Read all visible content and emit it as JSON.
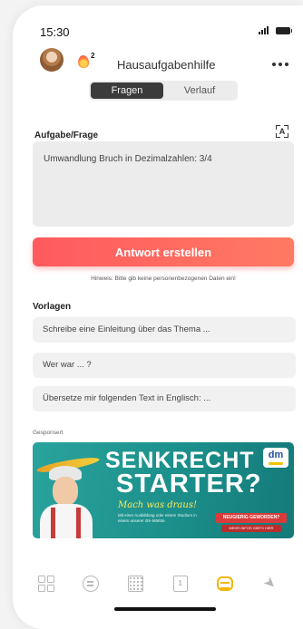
{
  "status_bar": {
    "time": "15:30"
  },
  "header": {
    "title": "Hausaufgabenhilfe",
    "streak_count": "2"
  },
  "tabs": [
    {
      "label": "Fragen",
      "active": true
    },
    {
      "label": "Verlauf",
      "active": false
    }
  ],
  "question": {
    "label": "Aufgabe/Frage",
    "value": "Umwandlung Bruch in Dezimalzahlen: 3/4"
  },
  "cta": {
    "label": "Antwort erstellen"
  },
  "hint": "Hinweis: Bitte gib keine personenbezogenen Daten ein!",
  "templates": {
    "label": "Vorlagen",
    "items": [
      "Schreibe eine Einleitung über das Thema ...",
      "Wer war ... ?",
      "Übersetze mir folgenden Text in Englisch: ..."
    ]
  },
  "ad": {
    "sponsored_label": "Gesponsert",
    "headline_1": "SENKRECHT",
    "headline_2": "STARTER?",
    "script": "Mach was draus!",
    "small_text": "Mit einer Ausbildung oder einem Studium in einem unserer dm-Märkte.",
    "logo": "dm",
    "badge_1": "NEUGIERIG GEWORDEN?",
    "badge_2": "MEHR INFOS GIBTS HIER"
  },
  "bottom_nav": {
    "items": [
      "dashboard-icon",
      "chat-icon",
      "calendar-icon",
      "flashcards-icon",
      "bot-icon",
      "rocket-icon"
    ],
    "active": "bot-icon",
    "active_color": "#f2b500",
    "inactive_color": "#b8b8b8"
  },
  "colors": {
    "cta_gradient_start": "#ff5a5f",
    "cta_gradient_end": "#ff7a62",
    "ad_background": "#1c8f8b"
  }
}
